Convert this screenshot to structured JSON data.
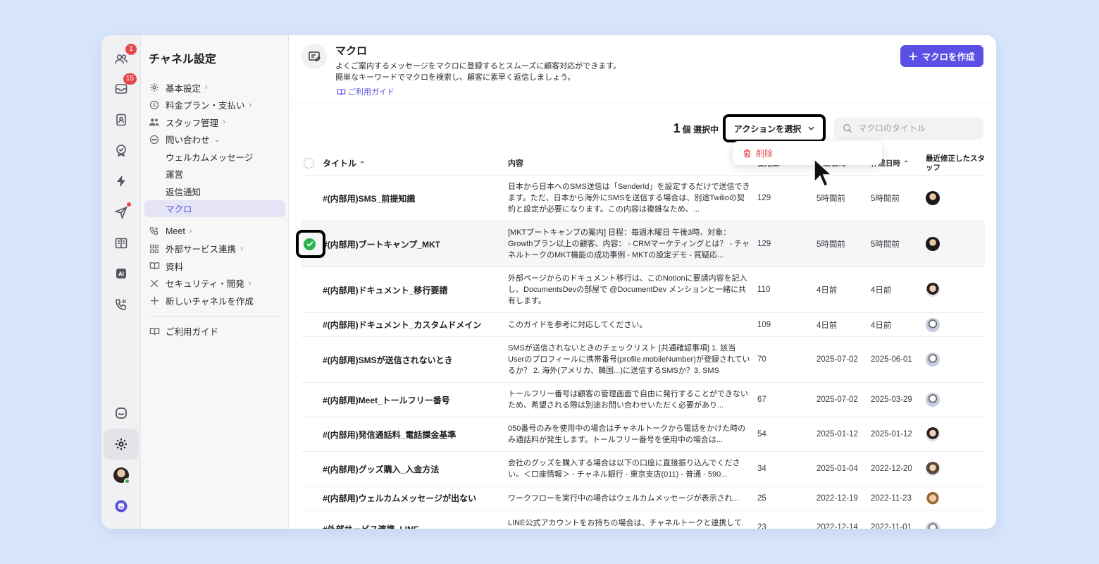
{
  "rail": {
    "badges": {
      "contacts": "1",
      "inbox": "15"
    }
  },
  "sidebar": {
    "title": "チャネル設定",
    "items": [
      {
        "label": "基本設定",
        "chevron": true
      },
      {
        "label": "料金プラン・支払い",
        "chevron": true
      },
      {
        "label": "スタッフ管理",
        "chevron": true
      },
      {
        "label": "問い合わせ",
        "chevron": "down"
      },
      {
        "label": "ウェルカムメッセージ"
      },
      {
        "label": "運営"
      },
      {
        "label": "返信通知"
      },
      {
        "label": "マクロ"
      },
      {
        "label": "Meet",
        "chevron": true
      },
      {
        "label": "外部サービス連携",
        "chevron": true
      },
      {
        "label": "資料"
      },
      {
        "label": "セキュリティ・開発",
        "chevron": true
      },
      {
        "label": "新しいチャネルを作成"
      },
      {
        "label": "ご利用ガイド"
      }
    ]
  },
  "header": {
    "title": "マクロ",
    "desc_line1": "よくご案内するメッセージをマクロに登録するとスムーズに顧客対応ができます。",
    "desc_line2": "簡単なキーワードでマクロを検索し、顧客に素早く返信しましょう。",
    "guide": "ご利用ガイド",
    "create_button": "マクロを作成"
  },
  "toolbar": {
    "selected_count": "1",
    "selected_suffix": "個 選択中",
    "action_label": "アクションを選択",
    "search_placeholder": "マクロのタイトル",
    "dropdown_delete": "削除"
  },
  "table": {
    "headers": {
      "title": "タイトル",
      "body": "内容",
      "usage": "使用数",
      "updated": "更新日時",
      "created": "作成日時",
      "staff": "最近修正したスタッフ"
    },
    "rows": [
      {
        "title": "#(内部用)SMS_前提知識",
        "body": "日本から日本へのSMS送信は「SenderId」を設定するだけで送信できます。ただ、日本から海外にSMSを送信する場合は、別途Twilioの契約と設定が必要になります。この内容は複雑なため、...",
        "usage": "129",
        "updated": "5時間前",
        "created": "5時間前",
        "selected": false
      },
      {
        "title": "#(内部用)ブートキャンプ_MKT",
        "body": "[MKTブートキャンプの案内] 日程：毎週木曜日 午後3時、対象：Growthプラン以上の顧客、内容： - CRMマーケティングとは？ - チャネルトークのMKT機能の成功事例 - MKTの設定デモ - 質疑応...",
        "usage": "129",
        "updated": "5時間前",
        "created": "5時間前",
        "selected": true
      },
      {
        "title": "#(内部用)ドキュメント_移行要請",
        "body": "外部ページからのドキュメント移行は、このNotionに要請内容を記入し、DocumentsDevの部屋で @DocumentDev メンションと一緒に共有します。",
        "usage": "110",
        "updated": "4日前",
        "created": "4日前",
        "selected": false
      },
      {
        "title": "#(内部用)ドキュメント_カスタムドメイン",
        "body": "このガイドを参考に対応してください。",
        "usage": "109",
        "updated": "4日前",
        "created": "4日前",
        "selected": false
      },
      {
        "title": "#(内部用)SMSが送信されないとき",
        "body": "SMSが送信されないときのチェックリスト [共通確認事項] 1. 該当Userのプロフィールに携帯番号(profile.mobileNumber)が登録されているか？ 2. 海外(アメリカ、韓国...)に送信するSMSか？3. SMS",
        "usage": "70",
        "updated": "2025-07-02",
        "created": "2025-06-01",
        "selected": false
      },
      {
        "title": "#(内部用)Meet_トールフリー番号",
        "body": "トールフリー番号は顧客の管理画面で自由に発行することができないため、希望される際は別途お問い合わせいただく必要があり...",
        "usage": "67",
        "updated": "2025-07-02",
        "created": "2025-03-29",
        "selected": false
      },
      {
        "title": "#(内部用)発信通話料_電話課金基準",
        "body": "050番号のみを使用中の場合はチャネルトークから電話をかけた時のみ通話料が発生します。トールフリー番号を使用中の場合は...",
        "usage": "54",
        "updated": "2025-01-12",
        "created": "2025-01-12",
        "selected": false
      },
      {
        "title": "#(内部用)グッズ購入_入金方法",
        "body": "会社のグッズを購入する場合は以下の口座に直接振り込んでください。＜口座情報＞ - チャネル銀行 - 東京支店(011) - 普通 - 590...",
        "usage": "34",
        "updated": "2025-01-04",
        "created": "2022-12-20",
        "selected": false
      },
      {
        "title": "#(内部用)ウェルカムメッセージが出ない",
        "body": "ワークフローを実行中の場合はウェルカムメッセージが表示され...",
        "usage": "25",
        "updated": "2022-12-19",
        "created": "2022-11-23",
        "selected": false
      },
      {
        "title": "#外部サービス連携_LINE",
        "body": "LINE公式アカウントをお持ちの場合は、チャネルトークと連携して",
        "usage": "23",
        "updated": "2022-12-14",
        "created": "2022-11-01",
        "selected": false
      }
    ]
  }
}
